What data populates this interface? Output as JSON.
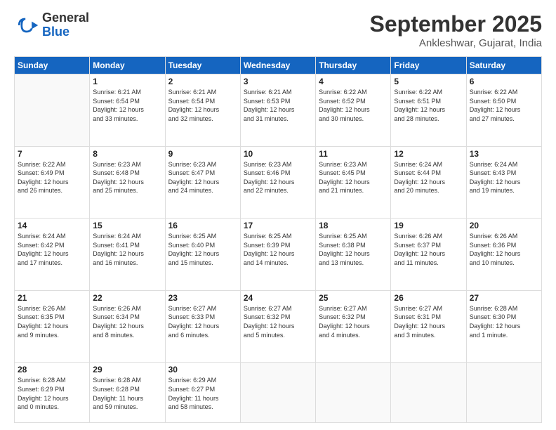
{
  "logo": {
    "general": "General",
    "blue": "Blue"
  },
  "title": "September 2025",
  "location": "Ankleshwar, Gujarat, India",
  "days_header": [
    "Sunday",
    "Monday",
    "Tuesday",
    "Wednesday",
    "Thursday",
    "Friday",
    "Saturday"
  ],
  "weeks": [
    [
      {
        "day": "",
        "info": ""
      },
      {
        "day": "1",
        "info": "Sunrise: 6:21 AM\nSunset: 6:54 PM\nDaylight: 12 hours\nand 33 minutes."
      },
      {
        "day": "2",
        "info": "Sunrise: 6:21 AM\nSunset: 6:54 PM\nDaylight: 12 hours\nand 32 minutes."
      },
      {
        "day": "3",
        "info": "Sunrise: 6:21 AM\nSunset: 6:53 PM\nDaylight: 12 hours\nand 31 minutes."
      },
      {
        "day": "4",
        "info": "Sunrise: 6:22 AM\nSunset: 6:52 PM\nDaylight: 12 hours\nand 30 minutes."
      },
      {
        "day": "5",
        "info": "Sunrise: 6:22 AM\nSunset: 6:51 PM\nDaylight: 12 hours\nand 28 minutes."
      },
      {
        "day": "6",
        "info": "Sunrise: 6:22 AM\nSunset: 6:50 PM\nDaylight: 12 hours\nand 27 minutes."
      }
    ],
    [
      {
        "day": "7",
        "info": "Sunrise: 6:22 AM\nSunset: 6:49 PM\nDaylight: 12 hours\nand 26 minutes."
      },
      {
        "day": "8",
        "info": "Sunrise: 6:23 AM\nSunset: 6:48 PM\nDaylight: 12 hours\nand 25 minutes."
      },
      {
        "day": "9",
        "info": "Sunrise: 6:23 AM\nSunset: 6:47 PM\nDaylight: 12 hours\nand 24 minutes."
      },
      {
        "day": "10",
        "info": "Sunrise: 6:23 AM\nSunset: 6:46 PM\nDaylight: 12 hours\nand 22 minutes."
      },
      {
        "day": "11",
        "info": "Sunrise: 6:23 AM\nSunset: 6:45 PM\nDaylight: 12 hours\nand 21 minutes."
      },
      {
        "day": "12",
        "info": "Sunrise: 6:24 AM\nSunset: 6:44 PM\nDaylight: 12 hours\nand 20 minutes."
      },
      {
        "day": "13",
        "info": "Sunrise: 6:24 AM\nSunset: 6:43 PM\nDaylight: 12 hours\nand 19 minutes."
      }
    ],
    [
      {
        "day": "14",
        "info": "Sunrise: 6:24 AM\nSunset: 6:42 PM\nDaylight: 12 hours\nand 17 minutes."
      },
      {
        "day": "15",
        "info": "Sunrise: 6:24 AM\nSunset: 6:41 PM\nDaylight: 12 hours\nand 16 minutes."
      },
      {
        "day": "16",
        "info": "Sunrise: 6:25 AM\nSunset: 6:40 PM\nDaylight: 12 hours\nand 15 minutes."
      },
      {
        "day": "17",
        "info": "Sunrise: 6:25 AM\nSunset: 6:39 PM\nDaylight: 12 hours\nand 14 minutes."
      },
      {
        "day": "18",
        "info": "Sunrise: 6:25 AM\nSunset: 6:38 PM\nDaylight: 12 hours\nand 13 minutes."
      },
      {
        "day": "19",
        "info": "Sunrise: 6:26 AM\nSunset: 6:37 PM\nDaylight: 12 hours\nand 11 minutes."
      },
      {
        "day": "20",
        "info": "Sunrise: 6:26 AM\nSunset: 6:36 PM\nDaylight: 12 hours\nand 10 minutes."
      }
    ],
    [
      {
        "day": "21",
        "info": "Sunrise: 6:26 AM\nSunset: 6:35 PM\nDaylight: 12 hours\nand 9 minutes."
      },
      {
        "day": "22",
        "info": "Sunrise: 6:26 AM\nSunset: 6:34 PM\nDaylight: 12 hours\nand 8 minutes."
      },
      {
        "day": "23",
        "info": "Sunrise: 6:27 AM\nSunset: 6:33 PM\nDaylight: 12 hours\nand 6 minutes."
      },
      {
        "day": "24",
        "info": "Sunrise: 6:27 AM\nSunset: 6:32 PM\nDaylight: 12 hours\nand 5 minutes."
      },
      {
        "day": "25",
        "info": "Sunrise: 6:27 AM\nSunset: 6:32 PM\nDaylight: 12 hours\nand 4 minutes."
      },
      {
        "day": "26",
        "info": "Sunrise: 6:27 AM\nSunset: 6:31 PM\nDaylight: 12 hours\nand 3 minutes."
      },
      {
        "day": "27",
        "info": "Sunrise: 6:28 AM\nSunset: 6:30 PM\nDaylight: 12 hours\nand 1 minute."
      }
    ],
    [
      {
        "day": "28",
        "info": "Sunrise: 6:28 AM\nSunset: 6:29 PM\nDaylight: 12 hours\nand 0 minutes."
      },
      {
        "day": "29",
        "info": "Sunrise: 6:28 AM\nSunset: 6:28 PM\nDaylight: 11 hours\nand 59 minutes."
      },
      {
        "day": "30",
        "info": "Sunrise: 6:29 AM\nSunset: 6:27 PM\nDaylight: 11 hours\nand 58 minutes."
      },
      {
        "day": "",
        "info": ""
      },
      {
        "day": "",
        "info": ""
      },
      {
        "day": "",
        "info": ""
      },
      {
        "day": "",
        "info": ""
      }
    ]
  ]
}
